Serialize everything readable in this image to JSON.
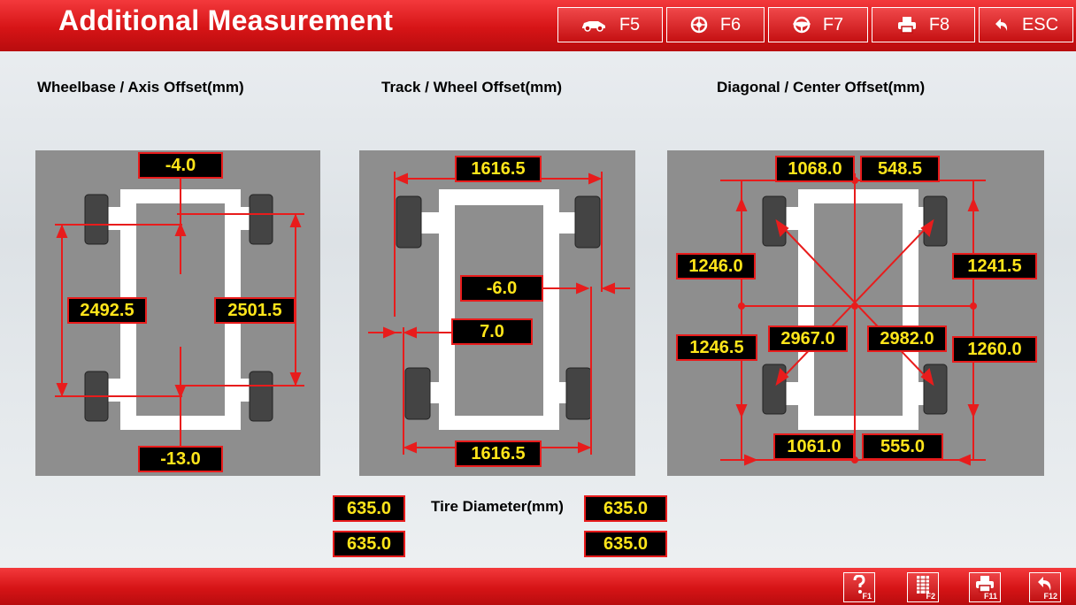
{
  "header": {
    "title": "Additional Measurement",
    "buttons": [
      {
        "key": "F5",
        "icon": "car-icon"
      },
      {
        "key": "F6",
        "icon": "wheel-icon"
      },
      {
        "key": "F7",
        "icon": "steering-wheel-icon"
      },
      {
        "key": "F8",
        "icon": "printer-icon"
      },
      {
        "key": "ESC",
        "icon": "back-arrow-icon"
      }
    ]
  },
  "sections": {
    "wheelbase": {
      "title": "Wheelbase / Axis Offset(mm)",
      "front_axis_offset": "-4.0",
      "rear_axis_offset": "-13.0",
      "left_wheelbase": "2492.5",
      "right_wheelbase": "2501.5"
    },
    "track": {
      "title": "Track / Wheel Offset(mm)",
      "front_track": "1616.5",
      "rear_track": "1616.5",
      "right_wheel_offset": "-6.0",
      "left_wheel_offset": "7.0"
    },
    "diagonal": {
      "title": "Diagonal / Center Offset(mm)",
      "front_left_half": "1068.0",
      "front_right_half": "548.5",
      "rear_left_half": "1061.0",
      "rear_right_half": "555.0",
      "left_front_half": "1246.0",
      "left_rear_half": "1246.5",
      "right_front_half": "1241.5",
      "right_rear_half": "1260.0",
      "diagonal_1": "2967.0",
      "diagonal_2": "2982.0"
    }
  },
  "tire_diameter": {
    "label": "Tire Diameter(mm)",
    "front_left": "635.0",
    "rear_left": "635.0",
    "front_right": "635.0",
    "rear_right": "635.0"
  },
  "footer": {
    "buttons": [
      {
        "key": "F1",
        "icon": "help-icon"
      },
      {
        "key": "F2",
        "icon": "tire-pattern-icon"
      },
      {
        "key": "F11",
        "icon": "printer-icon"
      },
      {
        "key": "F12",
        "icon": "return-icon"
      }
    ]
  },
  "colors": {
    "accent_red": "#d61416",
    "value_text": "#ffe51a",
    "panel_gray": "#8e8e8e"
  }
}
